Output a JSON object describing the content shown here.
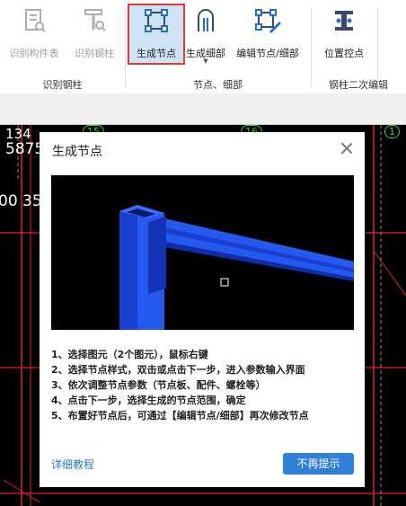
{
  "ribbon": {
    "buttons": [
      {
        "label": "识别构件表",
        "state": "disabled",
        "icon": "table-recognize-icon"
      },
      {
        "label": "识别钢柱",
        "state": "disabled",
        "icon": "column-recognize-icon"
      },
      {
        "label": "生成节点",
        "state": "active",
        "icon": "generate-node-icon"
      },
      {
        "label": "生成细部",
        "state": "normal",
        "icon": "generate-detail-icon"
      },
      {
        "label": "编辑节点/细部",
        "state": "normal",
        "icon": "edit-node-icon"
      },
      {
        "label": "位置控点",
        "state": "normal",
        "icon": "position-control-icon"
      }
    ],
    "groups": [
      "识别钢柱",
      "节点、细部",
      "钢柱二次编辑"
    ]
  },
  "canvas": {
    "text_a": "134",
    "text_b": "5875",
    "text_c": "00 350",
    "axis_a": "15",
    "axis_b": "16",
    "axis_c": "1"
  },
  "dialog": {
    "title": "生成节点",
    "steps": [
      "1、选择图元（2个图元），鼠标右键",
      "2、选择节点样式，双击或点击下一步，进入参数输入界面",
      "3、依次调整节点参数（节点板、配件、螺栓等）",
      "4、点击下一步，选择生成的节点范围，确定",
      "5、布置好节点后，可通过【编辑节点/细部】再次修改节点"
    ],
    "tutorial_link": "详细教程",
    "dismiss_button": "不再提示"
  },
  "colors": {
    "accent": "#2f80d7",
    "active_highlight": "#e53935",
    "steel": "#1f4fe0",
    "grid_red": "#d9262b"
  }
}
